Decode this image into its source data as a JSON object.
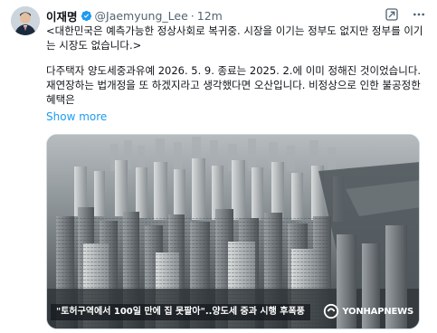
{
  "tweet": {
    "author_name": "이재명",
    "handle": "@Jaemyung_Lee",
    "separator": "·",
    "time": "12m",
    "paragraphs": [
      "<대한민국은 예측가능한 정상사회로 복귀중. 시장을 이기는 정부도 없지만 정부를 이기는 시장도 없습니다.>",
      "다주택자 양도세중과유예 2026. 5. 9. 종료는 2025. 2.에 이미 정해진 것이었습니다. 재연장하는 법개정을 또 하겠지라고 생각했다면 오산입니다. 비정상으로 인한 불공정한 혜택은"
    ],
    "show_more": "Show more"
  },
  "media": {
    "caption": "\"토허구역에서 100일 만에 집 못팔아\"..양도세 중과 시행 후폭풍",
    "watermark_text": "YONHAPNEWS",
    "description_icon": "aerial-city-photo"
  },
  "colors": {
    "link": "#1d9bf0",
    "verified": "#1d9bf0",
    "secondary_text": "#536471"
  },
  "icons": {
    "actions": [
      "grok-icon",
      "more-icon"
    ]
  }
}
